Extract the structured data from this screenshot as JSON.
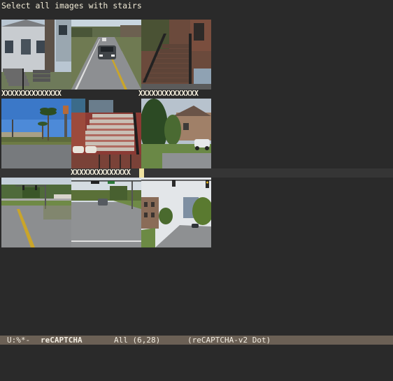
{
  "prompt": "Select all images with stairs",
  "tiles": [
    {
      "name": "house-with-porch-steps"
    },
    {
      "name": "road-with-car"
    },
    {
      "name": "brownstone-stoop"
    },
    {
      "name": "palm-trees-street"
    },
    {
      "name": "brick-staircase"
    },
    {
      "name": "suburban-trees"
    },
    {
      "name": "intersection-traffic-lights"
    },
    {
      "name": "road-with-traffic-light"
    },
    {
      "name": "city-street-traffic-light"
    }
  ],
  "selection_markers": {
    "tile1": "XXXXXXXXXXXXXX",
    "tile3": "XXXXXXXXXXXXXX",
    "tile5": "XXXXXXXXXXXXXX"
  },
  "modeline": {
    "status": "U:%*-",
    "buffer": "reCAPTCHA",
    "position": "All (6,28)",
    "mode": "(reCAPTCHA-v2 Dot)"
  }
}
